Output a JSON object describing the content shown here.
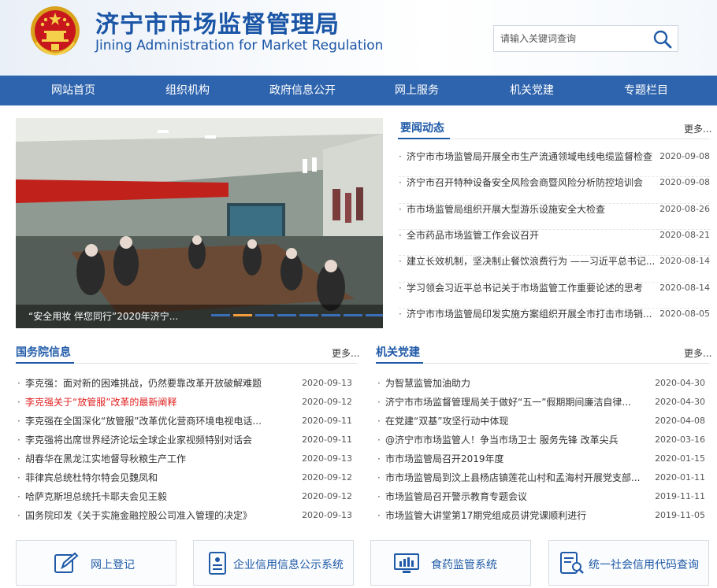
{
  "header": {
    "title_cn": "济宁市市场监督管理局",
    "title_en": "Jining Administration for Market Regulation",
    "search_placeholder": "请输入关键词查询",
    "brand_color": "#1a55a6"
  },
  "nav": {
    "background": "#2e64ad",
    "items": [
      "网站首页",
      "组织机构",
      "政府信息公开",
      "网上服务",
      "机关党建",
      "专题栏目"
    ]
  },
  "slider": {
    "caption": "“安全用妆 伴您同行”2020年济宁...",
    "total_slides": 8,
    "active_slide": 2
  },
  "news": {
    "title": "要闻动态",
    "more": "更多...",
    "items": [
      {
        "text": "济宁市市场监管局开展全市生产流通领域电线电缆监督检查",
        "date": "2020-09-08"
      },
      {
        "text": "济宁市召开特种设备安全风险会商暨风险分析防控培训会",
        "date": "2020-09-08"
      },
      {
        "text": "市市场监管局组织开展大型游乐设施安全大检查",
        "date": "2020-08-26"
      },
      {
        "text": "全市药品市场监管工作会议召开",
        "date": "2020-08-21"
      },
      {
        "text": "建立长效机制，坚决制止餐饮浪费行为 ——习近平总书记...",
        "date": "2020-08-14"
      },
      {
        "text": "学习领会习近平总书记关于市场监管工作重要论述的思考",
        "date": "2020-08-14"
      },
      {
        "text": "济宁市市场监管局印发实施方案组织开展全市打击市场销...",
        "date": "2020-08-05"
      }
    ]
  },
  "state_council": {
    "title": "国务院信息",
    "more": "更多...",
    "items": [
      {
        "text": "李克强：面对新的困难挑战，仍然要靠改革开放破解难题",
        "date": "2020-09-13",
        "highlight": false
      },
      {
        "text": "李克强关于“放管服”改革的最新阐释",
        "date": "2020-09-12",
        "highlight": true
      },
      {
        "text": "李克强在全国深化“放管服”改革优化营商环境电视电话...",
        "date": "2020-09-11",
        "highlight": false
      },
      {
        "text": "李克强将出席世界经济论坛全球企业家视频特别对话会",
        "date": "2020-09-11",
        "highlight": false
      },
      {
        "text": "胡春华在黑龙江实地督导秋粮生产工作",
        "date": "2020-09-13",
        "highlight": false
      },
      {
        "text": "菲律宾总统杜特尔特会见魏凤和",
        "date": "2020-09-12",
        "highlight": false
      },
      {
        "text": "哈萨克斯坦总统托卡耶夫会见王毅",
        "date": "2020-09-12",
        "highlight": false
      },
      {
        "text": "国务院印发《关于实施金融控股公司准入管理的决定》",
        "date": "2020-09-13",
        "highlight": false
      }
    ]
  },
  "party": {
    "title": "机关党建",
    "more": "更多...",
    "items": [
      {
        "text": "为智慧监管加油助力",
        "date": "2020-04-30"
      },
      {
        "text": "济宁市市场监督管理局关于做好“五一”假期期间廉洁自律...",
        "date": "2020-04-30"
      },
      {
        "text": "在党建“双基”攻坚行动中体现",
        "date": "2020-04-08"
      },
      {
        "text": "@济宁市市场监管人！争当市场卫士 服务先锋 改革尖兵",
        "date": "2020-03-16"
      },
      {
        "text": "市市场监管局召开2019年度",
        "date": "2020-01-15"
      },
      {
        "text": "市市场监管局到汶上县杨店镇莲花山村和孟海村开展党支部...",
        "date": "2020-01-11"
      },
      {
        "text": "市场监管局召开警示教育专题会议",
        "date": "2019-11-11"
      },
      {
        "text": "市场监管大讲堂第17期党组成员讲党课顺利进行",
        "date": "2019-11-05"
      }
    ]
  },
  "quick_links": [
    {
      "label": "网上登记",
      "icon": "pen-edit-icon"
    },
    {
      "label": "企业信用信息公示系统",
      "icon": "id-card-icon"
    },
    {
      "label": "食药监管系统",
      "icon": "monitor-chart-icon"
    },
    {
      "label": "统一社会信用代码查询",
      "icon": "document-search-icon"
    }
  ]
}
